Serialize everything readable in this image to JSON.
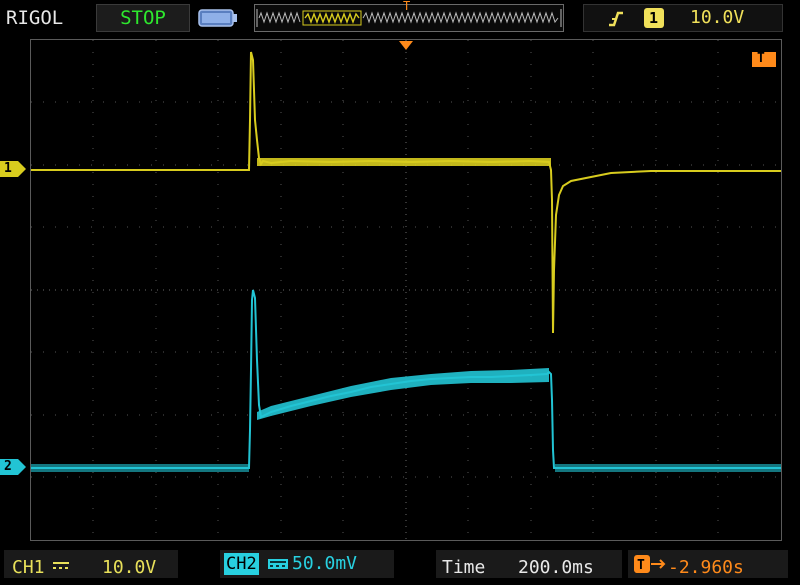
{
  "header": {
    "brand": "RIGOL",
    "run_status": "STOP",
    "trigger_source": "1",
    "trigger_level": "10.0V"
  },
  "markers": {
    "trigger_position": "T",
    "trigger_level_tag": "T",
    "ch1_ground": "1",
    "ch2_ground": "2"
  },
  "footer": {
    "ch1_label": "CH1",
    "ch1_scale": "10.0V",
    "ch2_label": "CH2",
    "ch2_scale": "50.0mV",
    "time_label": "Time",
    "time_value": "200.0ms",
    "offset_value": "-2.960s"
  },
  "colors": {
    "ch1": "#d8cc1e",
    "ch2": "#22c4d4",
    "accent": "#ff8a1a",
    "run": "#2ee82e"
  }
}
